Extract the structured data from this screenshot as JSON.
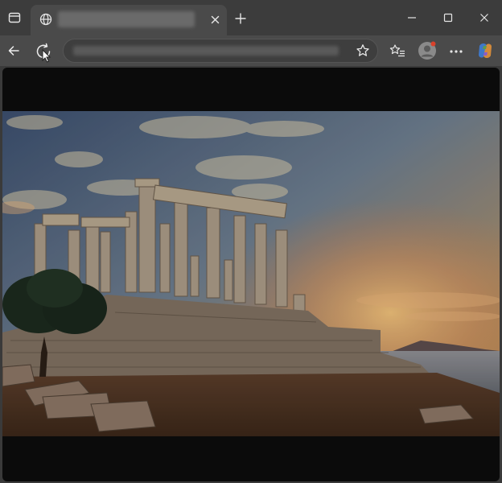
{
  "window": {
    "tab": {
      "title": ""
    },
    "address": {
      "url": ""
    }
  },
  "icons": {
    "tab_actions": "tab-actions-icon",
    "site": "globe-icon",
    "close_tab": "close-icon",
    "new_tab": "plus-icon",
    "minimize": "minimize-icon",
    "maximize": "maximize-icon",
    "close_window": "close-icon",
    "back": "arrow-left-icon",
    "refresh": "refresh-icon",
    "favorite": "star-icon",
    "favorites": "favorites-icon",
    "profile": "avatar",
    "more": "more-icon",
    "copilot": "copilot-icon"
  },
  "colors": {
    "titlebar": "#3c3c3c",
    "toolbar": "#4a4a4a",
    "viewport": "#0b0b0b",
    "notification_dot": "#d9412b"
  },
  "content": {
    "image_subject": "temple-ruins-at-sunset"
  }
}
